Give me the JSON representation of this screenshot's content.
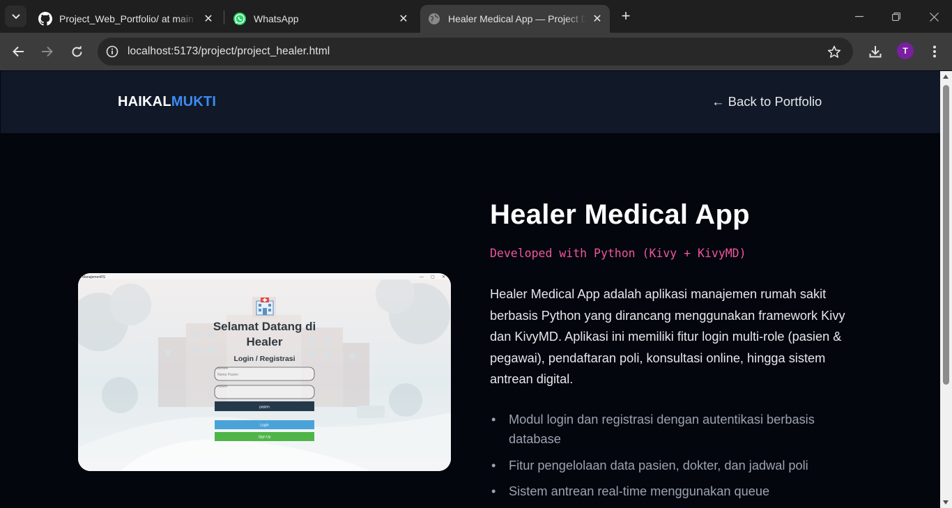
{
  "browser": {
    "tabs": [
      {
        "title": "Project_Web_Portfolio/ at main",
        "icon": "github-icon",
        "active": false
      },
      {
        "title": "WhatsApp",
        "icon": "whatsapp-icon",
        "active": false
      },
      {
        "title": "Healer Medical App — Project Detail",
        "icon": "globe-icon",
        "active": true
      }
    ],
    "url": "localhost:5173/project/project_healer.html",
    "profile_initial": "T",
    "profile_color": "#7b1fa2"
  },
  "site": {
    "logo_part1": "HAIKAL",
    "logo_part2": "MUKTI",
    "back_link": "← Back to Portfolio"
  },
  "project": {
    "title": "Healer Medical App",
    "tech": "Developed with Python (Kivy + KivyMD)",
    "description": "Healer Medical App adalah aplikasi manajemen rumah sakit berbasis Python yang dirancang menggunakan framework Kivy dan KivyMD. Aplikasi ini memiliki fitur login multi-role (pasien & pegawai), pendaftaran poli, konsultasi online, hingga sistem antrean digital.",
    "features": [
      "Modul login dan registrasi dengan autentikasi berbasis database",
      "Fitur pengelolaan data pasien, dokter, dan jadwal poli",
      "Sistem antrean real-time menggunakan queue"
    ],
    "screenshot": {
      "window_title": "ManajemenRS",
      "welcome": "Selamat Datang di Healer",
      "welcome_line1": "Selamat Datang di",
      "welcome_line2": "Healer",
      "subtitle": "Login / Registrasi",
      "username_label": "Username",
      "username_placeholder": "Nama Pasien",
      "password_label": "Password",
      "role_value": "pasien",
      "login_button": "Login",
      "signup_button": "Sign Up"
    }
  },
  "colors": {
    "accent_blue": "#3b8cf3",
    "accent_pink": "#f0569d",
    "header_bg": "#111827",
    "page_bg": "#03060d"
  }
}
